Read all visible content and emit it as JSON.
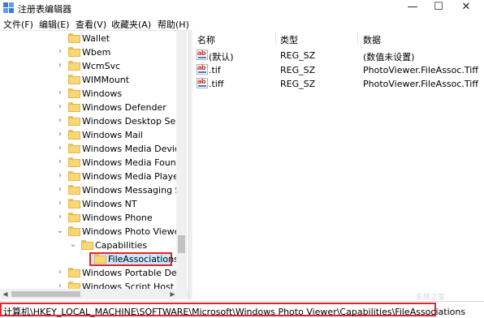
{
  "window": {
    "title": "注册表编辑器",
    "minimize": "—",
    "maximize": "☐",
    "close": "✕"
  },
  "menu": [
    "文件(F)",
    "编辑(E)",
    "查看(V)",
    "收藏夹(A)",
    "帮助(H)"
  ],
  "tree": [
    {
      "label": "Wallet",
      "chevron": ""
    },
    {
      "label": "Wbem",
      "chevron": "›"
    },
    {
      "label": "WcmSvc",
      "chevron": "›"
    },
    {
      "label": "WIMMount",
      "chevron": ""
    },
    {
      "label": "Windows",
      "chevron": "›"
    },
    {
      "label": "Windows Defender",
      "chevron": "›"
    },
    {
      "label": "Windows Desktop Sear",
      "chevron": "›"
    },
    {
      "label": "Windows Mail",
      "chevron": "›"
    },
    {
      "label": "Windows Media Device",
      "chevron": "›"
    },
    {
      "label": "Windows Media Founda",
      "chevron": "›"
    },
    {
      "label": "Windows Media Player",
      "chevron": "›"
    },
    {
      "label": "Windows Messaging Su",
      "chevron": "›"
    },
    {
      "label": "Windows NT",
      "chevron": "›"
    },
    {
      "label": "Windows Phone",
      "chevron": "›"
    },
    {
      "label": "Windows Photo Viewer",
      "chevron": "⌄"
    },
    {
      "label": "Capabilities",
      "chevron": "⌄"
    },
    {
      "label": "FileAssociations",
      "chevron": ""
    },
    {
      "label": "Windows Portable Devi",
      "chevron": "›"
    },
    {
      "label": "Windows Script Host",
      "chevron": "›"
    }
  ],
  "list": {
    "headers": {
      "name": "名称",
      "type": "类型",
      "data": "数据"
    },
    "rows": [
      {
        "name": "(默认)",
        "type": "REG_SZ",
        "data": "(数值未设置)"
      },
      {
        "name": ".tif",
        "type": "REG_SZ",
        "data": "PhotoViewer.FileAssoc.Tiff"
      },
      {
        "name": ".tiff",
        "type": "REG_SZ",
        "data": "PhotoViewer.FileAssoc.Tiff"
      }
    ],
    "icon_text": "ab"
  },
  "status": {
    "path": "计算机\\HKEY_LOCAL_MACHINE\\SOFTWARE\\Microsoft\\Windows Photo Viewer\\Capabilities\\FileAssociations"
  },
  "watermark": "系统之家",
  "colors": {
    "highlight": "#e0262d",
    "selection": "#cce8ff",
    "folder": "#f8d775"
  }
}
